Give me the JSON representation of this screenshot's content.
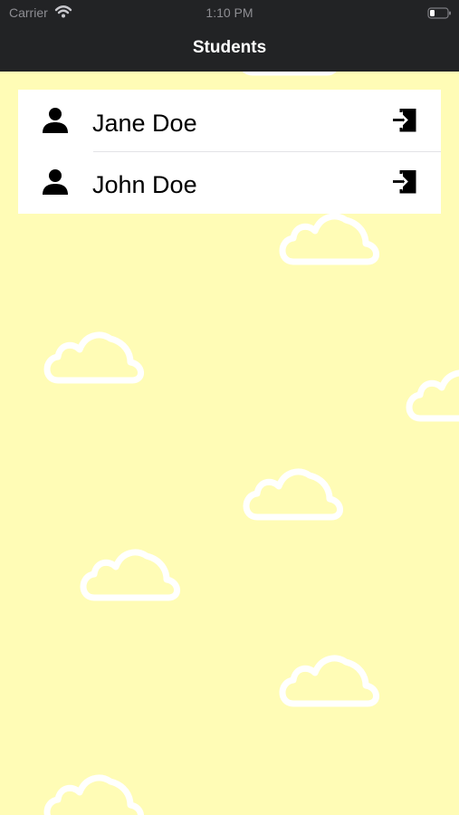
{
  "status_bar": {
    "carrier": "Carrier",
    "time": "1:10 PM",
    "icons": [
      "wifi-icon",
      "battery-icon"
    ]
  },
  "nav": {
    "title": "Students"
  },
  "students": [
    {
      "name": "Jane Doe",
      "icon": "person-icon",
      "action_icon": "login-icon"
    },
    {
      "name": "John Doe",
      "icon": "person-icon",
      "action_icon": "login-icon"
    }
  ],
  "colors": {
    "background": "#fffcb6",
    "bar": "#222325",
    "cloud_outline": "#ffffff",
    "list_background": "#ffffff"
  }
}
